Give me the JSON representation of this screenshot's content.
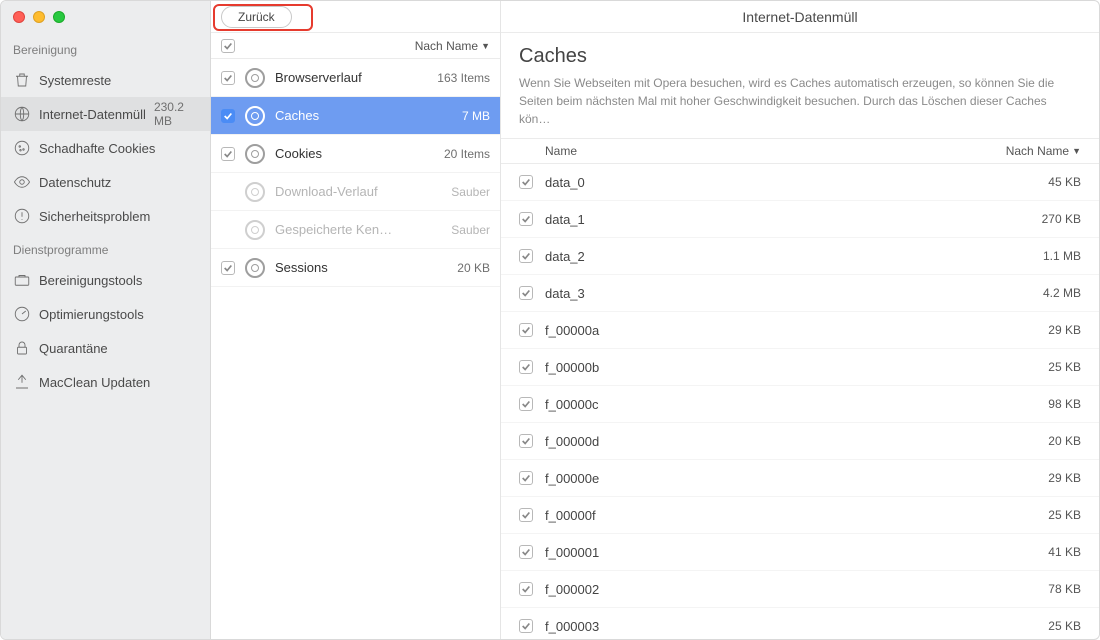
{
  "window_title": "Internet-Datenmüll",
  "back_button": "Zurück",
  "sidebar": {
    "sections": [
      {
        "title": "Bereinigung",
        "items": [
          {
            "icon": "trash-icon",
            "label": "Systemreste",
            "meta": "",
            "active": false
          },
          {
            "icon": "globe-icon",
            "label": "Internet-Datenmüll",
            "meta": "230.2 MB",
            "active": true
          },
          {
            "icon": "cookie-icon",
            "label": "Schadhafte Cookies",
            "meta": "",
            "active": false
          },
          {
            "icon": "eye-icon",
            "label": "Datenschutz",
            "meta": "",
            "active": false
          },
          {
            "icon": "alert-icon",
            "label": "Sicherheitsproblem",
            "meta": "",
            "active": false
          }
        ]
      },
      {
        "title": "Dienstprogramme",
        "items": [
          {
            "icon": "toolbox-icon",
            "label": "Bereinigungstools",
            "meta": "",
            "active": false
          },
          {
            "icon": "gauge-icon",
            "label": "Optimierungstools",
            "meta": "",
            "active": false
          },
          {
            "icon": "lock-icon",
            "label": "Quarantäne",
            "meta": "",
            "active": false
          },
          {
            "icon": "update-icon",
            "label": "MacClean Updaten",
            "meta": "",
            "active": false
          }
        ]
      }
    ]
  },
  "middle": {
    "sort_label": "Nach Name",
    "items": [
      {
        "checked": true,
        "name": "Browserverlauf",
        "meta": "163 Items",
        "state": "normal"
      },
      {
        "checked": true,
        "name": "Caches",
        "meta": "7 MB",
        "state": "selected"
      },
      {
        "checked": true,
        "name": "Cookies",
        "meta": "20 Items",
        "state": "normal"
      },
      {
        "checked": false,
        "name": "Download-Verlauf",
        "meta": "Sauber",
        "state": "dim"
      },
      {
        "checked": false,
        "name": "Gespeicherte Ken…",
        "meta": "Sauber",
        "state": "dim"
      },
      {
        "checked": true,
        "name": "Sessions",
        "meta": "20 KB",
        "state": "normal"
      }
    ]
  },
  "detail": {
    "title": "Caches",
    "description": "Wenn Sie Webseiten mit Opera besuchen, wird es Caches automatisch erzeugen, so können Sie die Seiten beim nächsten Mal mit hoher Geschwindigkeit besuchen. Durch das Löschen dieser Caches kön…",
    "col_name": "Name",
    "sort_label": "Nach Name",
    "files": [
      {
        "name": "data_0",
        "size": "45 KB"
      },
      {
        "name": "data_1",
        "size": "270 KB"
      },
      {
        "name": "data_2",
        "size": "1.1 MB"
      },
      {
        "name": "data_3",
        "size": "4.2 MB"
      },
      {
        "name": "f_00000a",
        "size": "29 KB"
      },
      {
        "name": "f_00000b",
        "size": "25 KB"
      },
      {
        "name": "f_00000c",
        "size": "98 KB"
      },
      {
        "name": "f_00000d",
        "size": "20 KB"
      },
      {
        "name": "f_00000e",
        "size": "29 KB"
      },
      {
        "name": "f_00000f",
        "size": "25 KB"
      },
      {
        "name": "f_000001",
        "size": "41 KB"
      },
      {
        "name": "f_000002",
        "size": "78 KB"
      },
      {
        "name": "f_000003",
        "size": "25 KB"
      }
    ]
  }
}
